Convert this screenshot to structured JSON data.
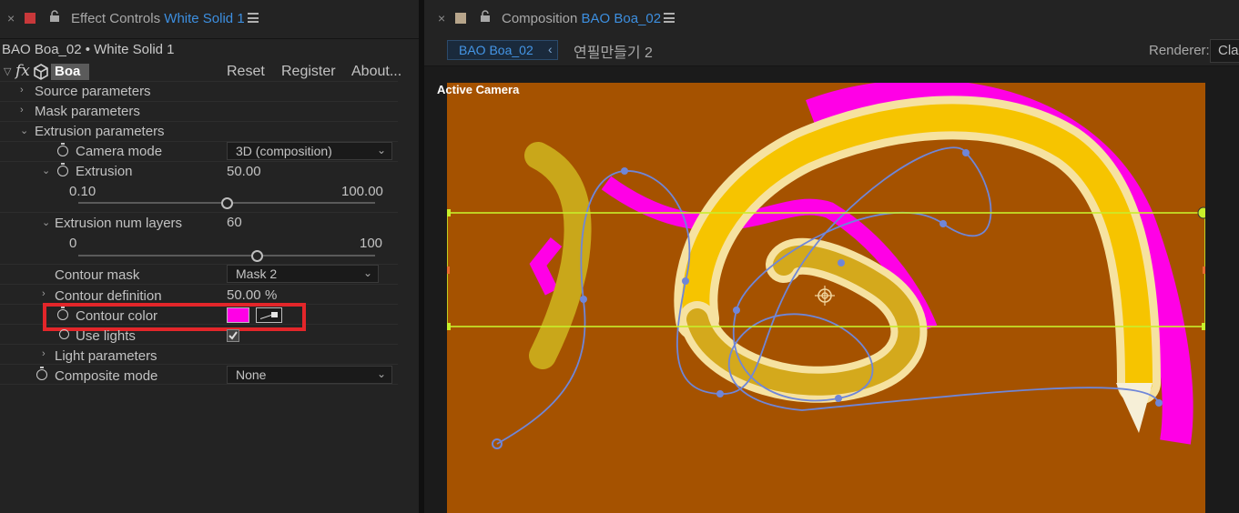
{
  "effect_panel": {
    "tab_close": "×",
    "tab_prefix": "Effect Controls",
    "tab_layer": "White Solid 1",
    "layer_title": "BAO Boa_02 • White Solid 1",
    "fx_label": "fx",
    "effect_name": "Boa",
    "reset": "Reset",
    "register": "Register",
    "about": "About...",
    "rows": {
      "source": "Source parameters",
      "mask": "Mask parameters",
      "extrusion_params": "Extrusion parameters",
      "camera_mode": "Camera mode",
      "camera_mode_value": "3D (composition)",
      "extrusion": "Extrusion",
      "extrusion_value": "50.00",
      "extrusion_min": "0.10",
      "extrusion_max": "100.00",
      "extrusion_layers": "Extrusion num layers",
      "extrusion_layers_value": "60",
      "layers_min": "0",
      "layers_max": "100",
      "contour_mask": "Contour mask",
      "contour_mask_value": "Mask 2",
      "contour_definition": "Contour definition",
      "contour_definition_value": "50.00",
      "contour_definition_unit": "%",
      "contour_color": "Contour color",
      "use_lights": "Use lights",
      "light_params": "Light parameters",
      "composite_mode": "Composite mode",
      "composite_mode_value": "None"
    },
    "extrusion_slider_fraction": 0.5,
    "layers_slider_fraction": 0.6
  },
  "comp_panel": {
    "tab_close": "×",
    "tab_prefix": "Composition",
    "tab_comp": "BAO Boa_02",
    "breadcrumb": "BAO Boa_02",
    "breadcrumb_chev": "‹",
    "next_comp": "연필만들기 2",
    "renderer_label": "Renderer:",
    "renderer_value": "Cla",
    "viewport_label": "Active Camera"
  },
  "colors": {
    "contour_color": "#ff00e6",
    "highlight_box": "#e3262a",
    "accent_blue": "#3d8fe0",
    "comp_background": "#a55200",
    "bounding_box": "#c8ef2a",
    "path_blue": "#6f86d8"
  },
  "icons": [
    "close-icon",
    "stop-icon",
    "lock-icon",
    "menu-icon",
    "fx-icon",
    "cube-icon",
    "chevron-right-icon",
    "chevron-down-icon",
    "stopwatch-icon",
    "eyedropper-icon",
    "checkbox-icon",
    "anchor-point-icon"
  ]
}
